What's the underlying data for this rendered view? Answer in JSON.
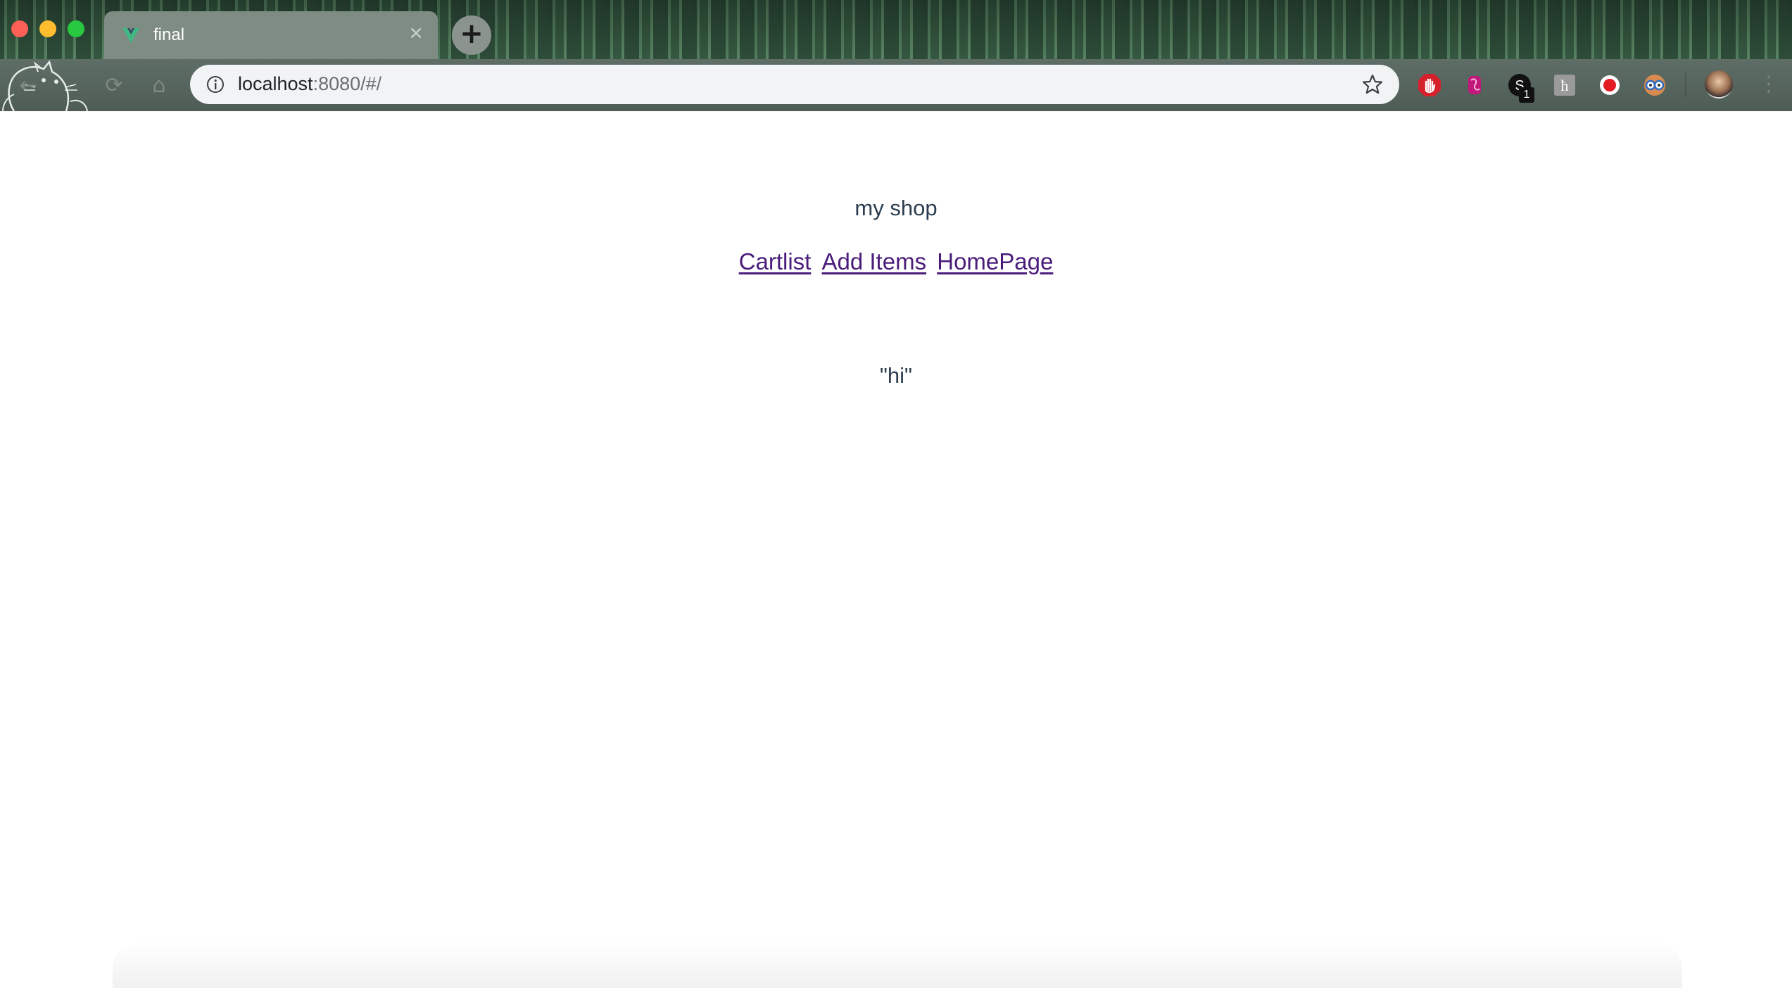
{
  "browser": {
    "tab_title": "final",
    "tab_close": "×",
    "new_tab": "+",
    "url_host": "localhost",
    "url_rest": ":8080/#/",
    "extension_badge": "1",
    "nav": {
      "back": "←",
      "reload": "⟳",
      "home": "⌂"
    },
    "menu": "⋮"
  },
  "page": {
    "title": "my shop",
    "links": {
      "cartlist": "Cartlist",
      "add_items": "Add Items",
      "homepage": "HomePage"
    },
    "content": "\"hi\""
  },
  "colors": {
    "link": "#4b1d7b",
    "text": "#2c3e50",
    "vue_green": "#41b883"
  },
  "icons": {
    "extensions": [
      "adblock-icon",
      "pink-extension-icon",
      "s-extension-icon",
      "h-extension-icon",
      "record-icon",
      "glasses-icon"
    ]
  }
}
